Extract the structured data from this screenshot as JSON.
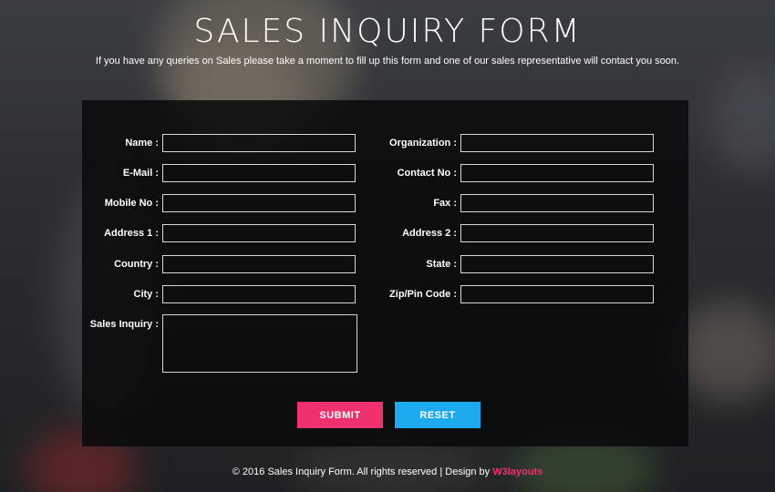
{
  "header": {
    "title": "SALES INQUIRY FORM",
    "subtitle": "If you have any queries on Sales please take a moment to fill up this form and one of our sales representative will contact you soon."
  },
  "form": {
    "left_fields": [
      {
        "label": "Name :",
        "value": ""
      },
      {
        "label": "E-Mail :",
        "value": ""
      },
      {
        "label": "Mobile No :",
        "value": ""
      },
      {
        "label": "Address 1 :",
        "value": ""
      },
      {
        "label": "Country :",
        "value": ""
      },
      {
        "label": "City :",
        "value": ""
      }
    ],
    "right_fields": [
      {
        "label": "Organization :",
        "value": ""
      },
      {
        "label": "Contact No :",
        "value": ""
      },
      {
        "label": "Fax :",
        "value": ""
      },
      {
        "label": "Address 2 :",
        "value": ""
      },
      {
        "label": "State :",
        "value": ""
      },
      {
        "label": "Zip/Pin Code :",
        "value": ""
      }
    ],
    "sales_inquiry": {
      "label": "Sales Inquiry :",
      "value": ""
    },
    "submit_label": "SUBMIT",
    "reset_label": "RESET"
  },
  "footer": {
    "text": "© 2016 Sales Inquiry Form. All rights reserved | Design by ",
    "link": "W3layouts"
  },
  "colors": {
    "submit": "#f0306f",
    "reset": "#1eaaee",
    "link": "#f0306f",
    "panel": "#08090a"
  }
}
